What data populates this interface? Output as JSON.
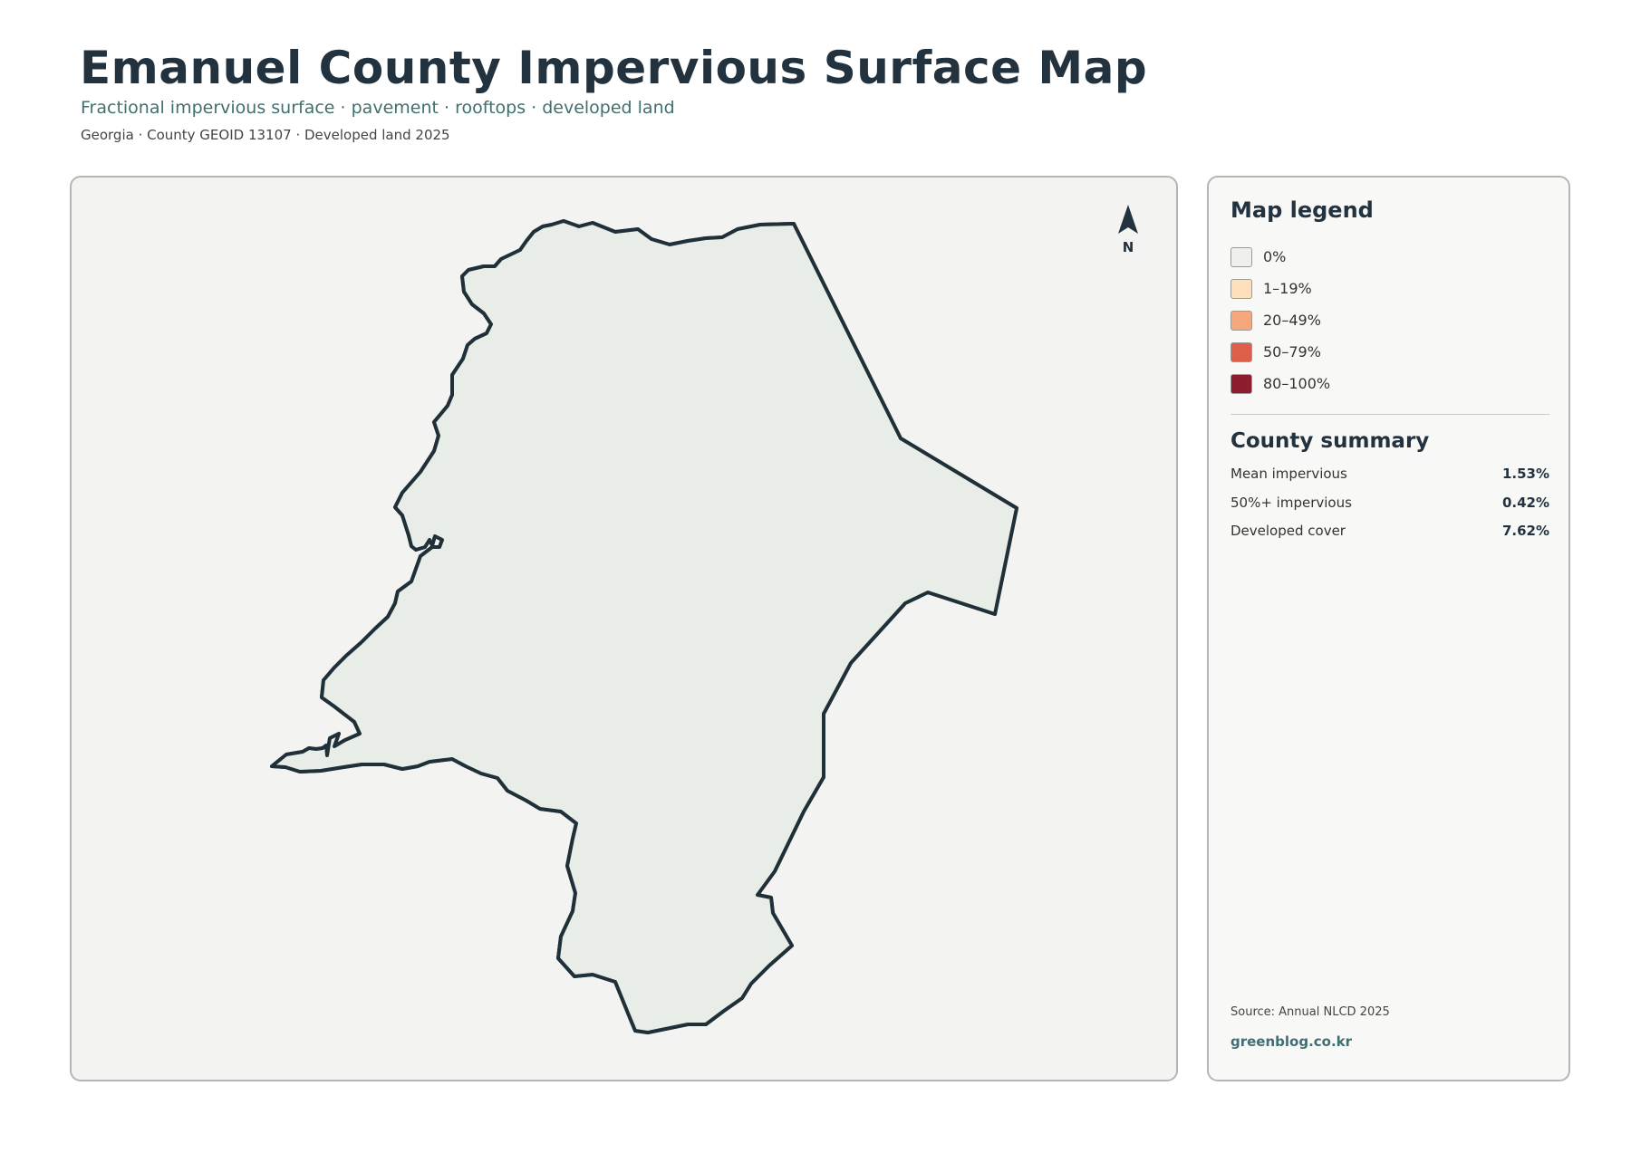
{
  "header": {
    "title": "Emanuel County Impervious Surface Map",
    "subtitle": "Fractional impervious surface · pavement · rooftops · developed land",
    "meta": "Georgia · County GEOID 13107 · Developed land 2025"
  },
  "map": {
    "north_label": "N",
    "fill_color": "#e9ede8",
    "outline_color": "#1f3038"
  },
  "legend": {
    "title": "Map legend",
    "items": [
      {
        "label": "0%",
        "color": "#efefec"
      },
      {
        "label": "1–19%",
        "color": "#fde0bc"
      },
      {
        "label": "20–49%",
        "color": "#f4a67c"
      },
      {
        "label": "50–79%",
        "color": "#dd5f4b"
      },
      {
        "label": "80–100%",
        "color": "#8c1c2e"
      }
    ]
  },
  "summary": {
    "title": "County summary",
    "rows": [
      {
        "label": "Mean impervious",
        "value": "1.53%"
      },
      {
        "label": "50%+ impervious",
        "value": "0.42%"
      },
      {
        "label": "Developed cover",
        "value": "7.62%"
      }
    ]
  },
  "footer": {
    "source": "Source: Annual NLCD 2025",
    "credit": "greenblog.co.kr"
  }
}
